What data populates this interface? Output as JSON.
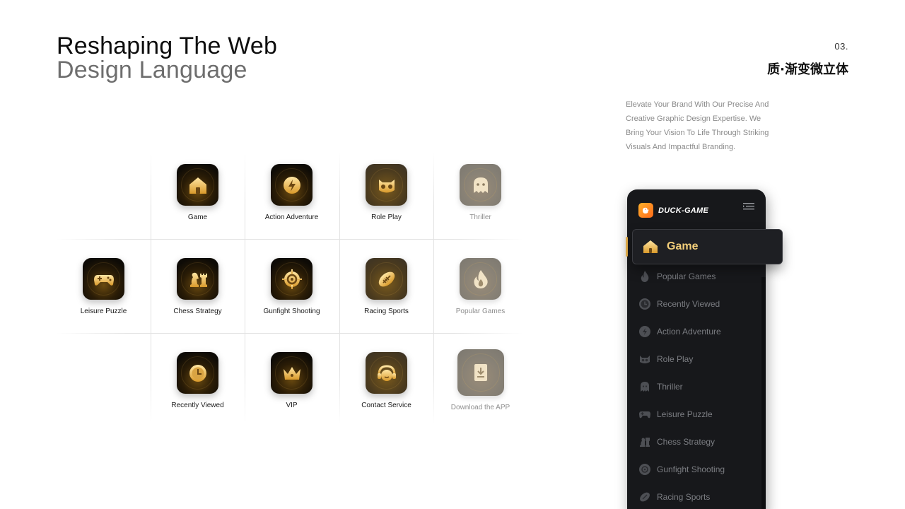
{
  "header": {
    "title_line1": "Reshaping The Web",
    "title_line2": "Design Language",
    "page_number": "03.",
    "page_subtitle": "质·渐变微立体"
  },
  "description": "Elevate Your Brand With Our Precise And Creative Graphic Design Expertise. We Bring Your Vision To Life Through Striking Visuals And Impactful Branding.",
  "grid": {
    "cells": [
      {
        "label": "Game",
        "icon": "house-icon",
        "dim": false
      },
      {
        "label": "Action Adventure",
        "icon": "lightning-icon",
        "dim": false
      },
      {
        "label": "Role Play",
        "icon": "cat-face-icon",
        "dim": false
      },
      {
        "label": "Thriller",
        "icon": "ghost-icon",
        "dim": true
      },
      {
        "label": "Leisure Puzzle",
        "icon": "gamepad-icon",
        "dim": false
      },
      {
        "label": "Chess Strategy",
        "icon": "chess-icon",
        "dim": false
      },
      {
        "label": "Gunfight Shooting",
        "icon": "crosshair-icon",
        "dim": false
      },
      {
        "label": "Racing Sports",
        "icon": "football-icon",
        "dim": false
      },
      {
        "label": "Popular Games",
        "icon": "flame-icon",
        "dim": true
      },
      {
        "label": "Recently Viewed",
        "icon": "clock-icon",
        "dim": false
      },
      {
        "label": "VIP",
        "icon": "crown-icon",
        "dim": false
      },
      {
        "label": "Contact Service",
        "icon": "headset-icon",
        "dim": false
      },
      {
        "label": "Download the APP",
        "icon": "download-icon",
        "dim": true
      }
    ]
  },
  "sidebar": {
    "brand": "DUCK-GAME",
    "active": {
      "label": "Game",
      "icon": "house-icon"
    },
    "items": [
      {
        "label": "Popular Games",
        "icon": "flame-icon"
      },
      {
        "label": "Recently Viewed",
        "icon": "clock-icon"
      },
      {
        "label": "Action Adventure",
        "icon": "lightning-icon"
      },
      {
        "label": "Role Play",
        "icon": "cat-face-icon"
      },
      {
        "label": "Thriller",
        "icon": "ghost-icon"
      },
      {
        "label": "Leisure Puzzle",
        "icon": "gamepad-icon"
      },
      {
        "label": "Chess Strategy",
        "icon": "chess-icon"
      },
      {
        "label": "Gunfight Shooting",
        "icon": "crosshair-icon"
      },
      {
        "label": "Racing Sports",
        "icon": "football-icon"
      }
    ]
  },
  "colors": {
    "gold": "#f4cf7a",
    "panel": "#17181b",
    "nav_text": "#7b7d82"
  }
}
